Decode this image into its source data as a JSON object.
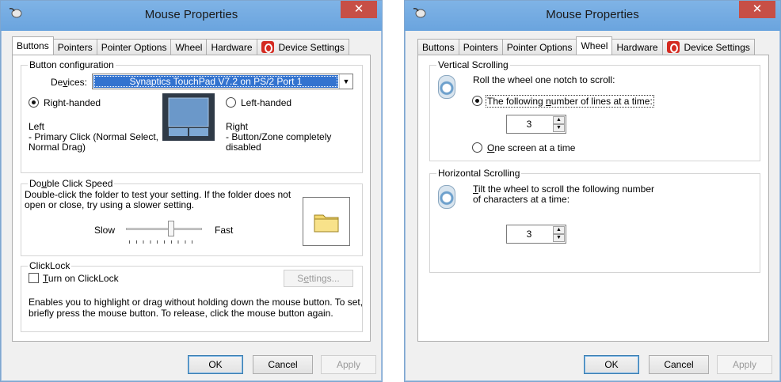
{
  "left": {
    "title": "Mouse Properties",
    "close": "✕",
    "tabs": [
      "Buttons",
      "Pointers",
      "Pointer Options",
      "Wheel",
      "Hardware",
      "Device Settings"
    ],
    "button_config": {
      "legend": "Button configuration",
      "devices_label": "Devices:",
      "devices_value": "Synaptics TouchPad V7.2 on PS/2 Port 1",
      "right_handed": "Right-handed",
      "left_handed": "Left-handed",
      "left_title": "Left",
      "left_desc1": "- Primary Click (Normal Select,",
      "left_desc2": "Normal Drag)",
      "right_title": "Right",
      "right_desc1": "- Button/Zone completely",
      "right_desc2": "disabled"
    },
    "dbl_click": {
      "legend": "Double Click Speed",
      "desc1": "Double-click the folder to test your setting.  If the folder does not",
      "desc2": "open or close, try using a slower setting.",
      "slow": "Slow",
      "fast": "Fast",
      "slider_level": 0.6
    },
    "clicklock": {
      "legend": "ClickLock",
      "checkbox_label": "Turn on ClickLock",
      "settings_btn": "Settings...",
      "desc1": "Enables you to highlight or drag without holding down the mouse button.  To set,",
      "desc2": "briefly press the mouse button.  To release, click the mouse button again."
    },
    "buttons": {
      "ok": "OK",
      "cancel": "Cancel",
      "apply": "Apply"
    }
  },
  "right": {
    "title": "Mouse Properties",
    "close": "✕",
    "tabs": [
      "Buttons",
      "Pointers",
      "Pointer Options",
      "Wheel",
      "Hardware",
      "Device Settings"
    ],
    "vertical": {
      "legend": "Vertical Scrolling",
      "prompt": "Roll the wheel one notch to scroll:",
      "opt_lines": "The following number of lines at a time:",
      "lines_value": "3",
      "opt_screen": "One screen at a time"
    },
    "horizontal": {
      "legend": "Horizontal Scrolling",
      "prompt1": "Tilt the wheel to scroll the following number",
      "prompt2": "of characters at a time:",
      "chars_value": "3"
    },
    "buttons": {
      "ok": "OK",
      "cancel": "Cancel",
      "apply": "Apply"
    }
  }
}
